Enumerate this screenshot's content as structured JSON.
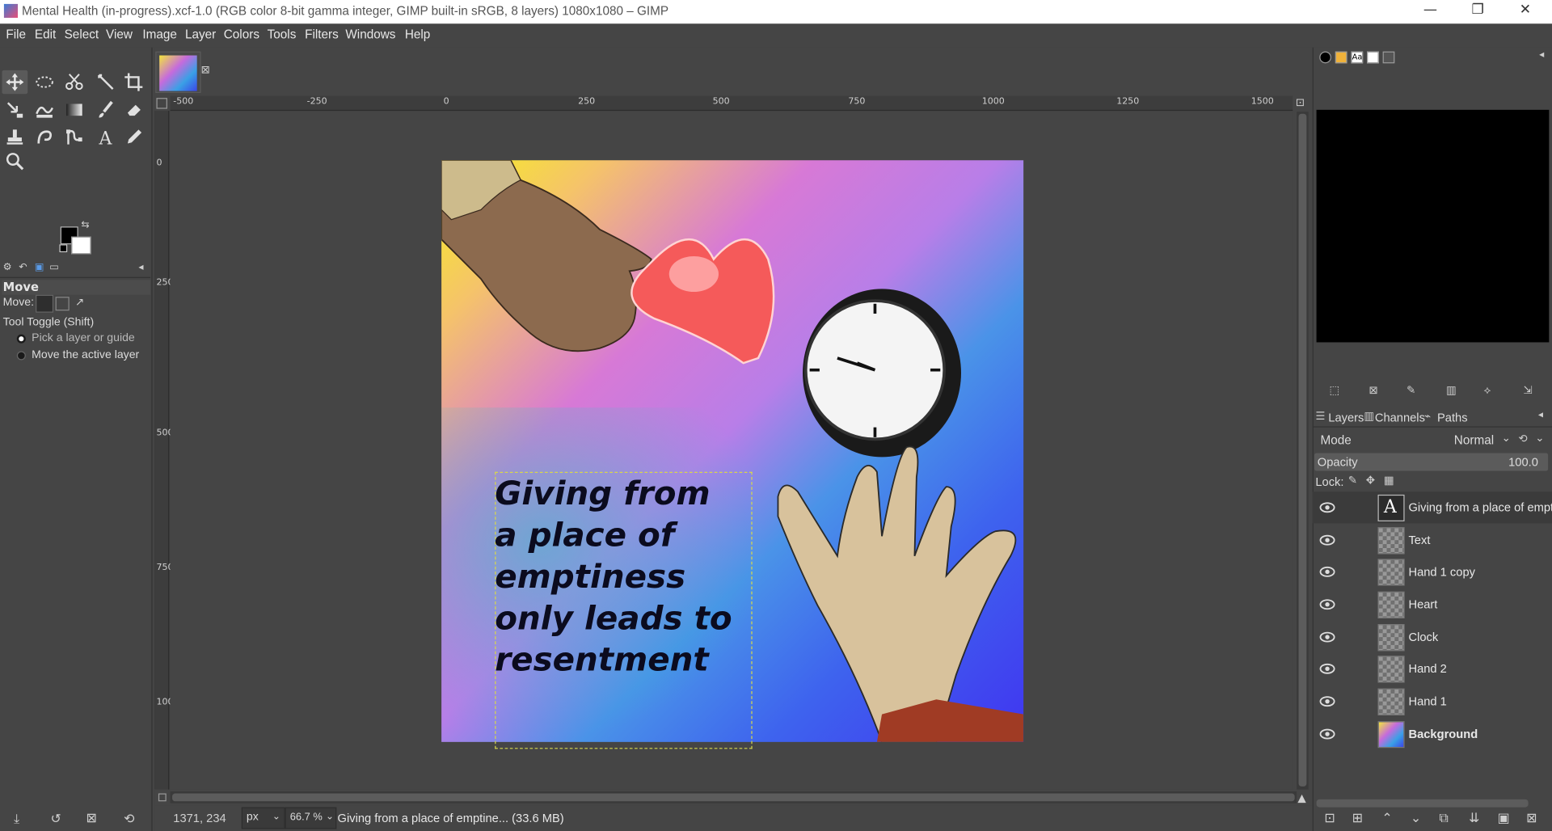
{
  "window": {
    "title": "Mental Health (in-progress).xcf-1.0 (RGB color 8-bit gamma integer, GIMP built-in sRGB, 8 layers) 1080x1080 – GIMP",
    "minimize": "—",
    "restore": "❐",
    "close": "✕"
  },
  "menu": [
    "File",
    "Edit",
    "Select",
    "View",
    "Image",
    "Layer",
    "Colors",
    "Tools",
    "Filters",
    "Windows",
    "Help"
  ],
  "tool_options": {
    "title": "Move",
    "move_label": "Move:",
    "toggle_label": "Tool Toggle  (Shift)",
    "option_pick": "Pick a layer or guide",
    "option_move_active": "Move the active layer"
  },
  "rulers": {
    "top": [
      "-500",
      "-250",
      "0",
      "250",
      "500",
      "750",
      "1000",
      "1250",
      "1500"
    ],
    "left": [
      "0",
      "250",
      "500",
      "750",
      "1000"
    ]
  },
  "image_text": [
    "Giving from",
    "a place of",
    "emptiness",
    "only leads to",
    "resentment"
  ],
  "statusbar": {
    "coords": "1371, 234",
    "unit": "px",
    "zoom": "66.7 %",
    "message": "Giving from a place of emptine... (33.6 MB)"
  },
  "layers_panel": {
    "tabs": [
      "Layers",
      "Channels",
      "Paths"
    ],
    "mode_label": "Mode",
    "mode_value": "Normal",
    "opacity_label": "Opacity",
    "opacity_value": "100.0",
    "lock_label": "Lock:",
    "layers": [
      {
        "name": "Giving from a place of empti",
        "selected": true,
        "bold": false
      },
      {
        "name": "Text",
        "selected": false,
        "bold": false
      },
      {
        "name": "Hand 1 copy",
        "selected": false,
        "bold": false
      },
      {
        "name": "Heart",
        "selected": false,
        "bold": false
      },
      {
        "name": "Clock",
        "selected": false,
        "bold": false
      },
      {
        "name": "Hand 2",
        "selected": false,
        "bold": false
      },
      {
        "name": "Hand 1",
        "selected": false,
        "bold": false
      },
      {
        "name": "Background",
        "selected": false,
        "bold": true
      }
    ]
  },
  "colors": {
    "foreground": "#000000",
    "background": "#ffffff"
  }
}
